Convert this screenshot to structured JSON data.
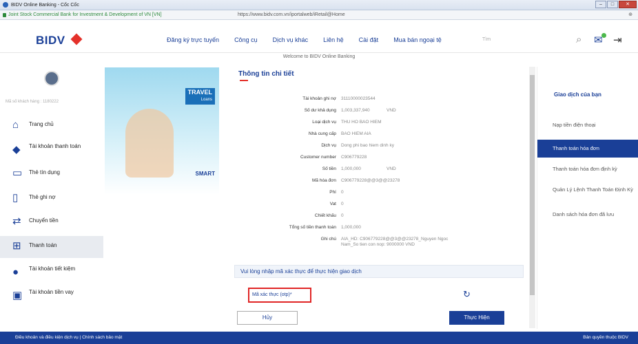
{
  "window": {
    "title": "BIDV Online Banking - Cốc Cốc"
  },
  "address_bar": {
    "org": "Joint Stock Commercial Bank for Investment & Development of VN [VN]",
    "url": "https://www.bidv.com.vn/iportalweb/iRetail@Home"
  },
  "nav": {
    "logo": "BIDV",
    "menu": [
      "Đăng ký trực tuyến",
      "Công cụ",
      "Dịch vụ khác",
      "Liên hệ",
      "Cài đặt",
      "Mua bán ngoại tệ"
    ],
    "search_placeholder": "Tìm"
  },
  "welcome": "Welcome to BIDV Online Banking",
  "sidebar": {
    "customer_label": "Mã số khách hàng : 1180222",
    "items": [
      {
        "label": "Trang chủ",
        "icon": "home-icon"
      },
      {
        "label": "Tài khoản thanh toán",
        "icon": "wallet-icon"
      },
      {
        "label": "Thẻ tín dụng",
        "icon": "credit-card-icon"
      },
      {
        "label": "Thẻ ghi nợ",
        "icon": "debit-card-icon"
      },
      {
        "label": "Chuyển tiền",
        "icon": "transfer-icon"
      },
      {
        "label": "Thanh toán",
        "icon": "payment-icon"
      },
      {
        "label": "Tài khoản tiết kiệm",
        "icon": "savings-icon"
      },
      {
        "label": "Tài khoản tiền vay",
        "icon": "loan-icon"
      }
    ]
  },
  "banner": {
    "tag_title": "TRAVEL",
    "tag_sub": "Loans",
    "brand": "SMART"
  },
  "detail": {
    "title": "Thông tin chi tiết",
    "rows": [
      {
        "label": "Tài khoản ghi nợ",
        "value": "31110000023544",
        "unit": ""
      },
      {
        "label": "Số dư khả dụng",
        "value": "1,003,337,940",
        "unit": "VND"
      },
      {
        "label": "Loại dịch vụ",
        "value": "THU HO BAO HIEM",
        "unit": ""
      },
      {
        "label": "Nhà cung cấp",
        "value": "BAO HIEM AIA",
        "unit": ""
      },
      {
        "label": "Dịch vụ",
        "value": "Dong phi bao hiem dinh ky",
        "unit": ""
      },
      {
        "label": "Customer number",
        "value": "C906779228",
        "unit": ""
      },
      {
        "label": "Số tiền",
        "value": "1,000,000",
        "unit": "VND"
      },
      {
        "label": "Mã hóa đơn",
        "value": "C906779228@@3@@23278",
        "unit": ""
      },
      {
        "label": "Phí",
        "value": "0",
        "unit": ""
      },
      {
        "label": "Vat",
        "value": "0",
        "unit": ""
      },
      {
        "label": "Chiết khấu",
        "value": "0",
        "unit": ""
      },
      {
        "label": "Tổng số tiền thanh toán",
        "value": "1,000,000",
        "unit": ""
      },
      {
        "label": "Ghi chú",
        "value": "AIA_HD: C906779228@@3@@23278_Nguyen Ngoc Nam_So tien con nop: 9000000 VND",
        "unit": ""
      }
    ],
    "notice": "Vui lòng nhập mã xác thực để thực hiện giao dịch",
    "otp_placeholder": "Mã xác thực (otp)*",
    "cancel_label": "Hủy",
    "submit_label": "Thực Hiện"
  },
  "right_panel": {
    "heading": "Giao dịch của bạn",
    "items": [
      "Nạp tiền điện thoại",
      "Thanh toán hóa đơn",
      "Thanh toán hóa đơn định kỳ",
      "Quản Lý Lệnh Thanh Toán Định Kỳ",
      "Danh sách hóa đơn đã lưu"
    ]
  },
  "footer": {
    "left": "Điều khoản và điều kiện dịch vụ | Chính sách bảo mật",
    "right": "Bản quyền thuộc BIDV"
  }
}
